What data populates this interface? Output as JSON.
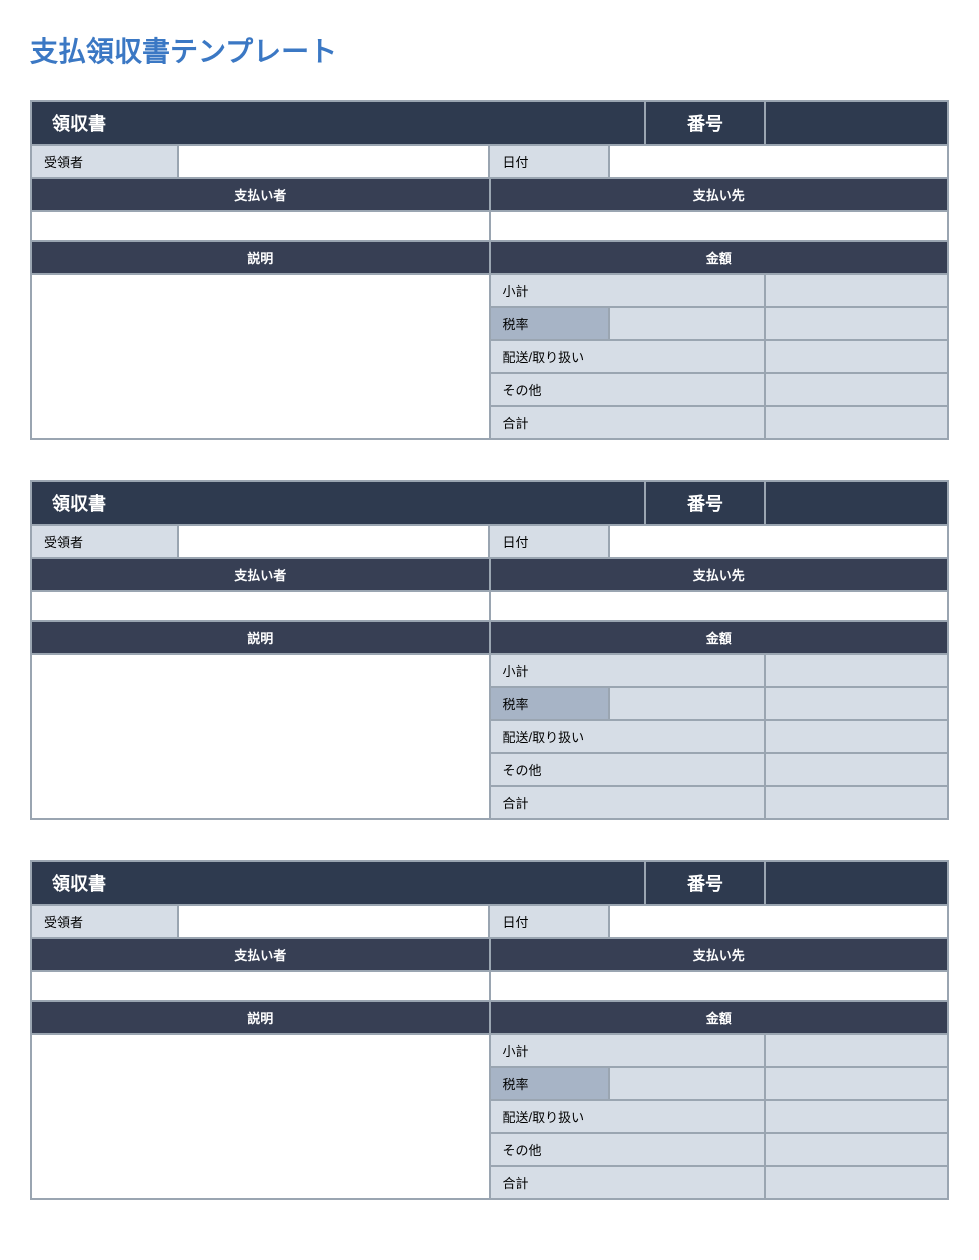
{
  "page_title": "支払領収書テンプレート",
  "receipt": {
    "title": "領収書",
    "number_label": "番号",
    "number_value": "",
    "recipient_label": "受領者",
    "recipient_value": "",
    "date_label": "日付",
    "date_value": "",
    "payer_header": "支払い者",
    "payer_value": "",
    "payee_header": "支払い先",
    "payee_value": "",
    "description_header": "説明",
    "description_value": "",
    "amount_header": "金額",
    "summary": {
      "subtotal_label": "小計",
      "subtotal_value": "",
      "taxrate_label": "税率",
      "taxrate_value": "",
      "taxrate_amount": "",
      "shipping_label": "配送/取り扱い",
      "shipping_value": "",
      "other_label": "その他",
      "other_value": "",
      "total_label": "合計",
      "total_value": ""
    }
  },
  "receipt_count": 3
}
